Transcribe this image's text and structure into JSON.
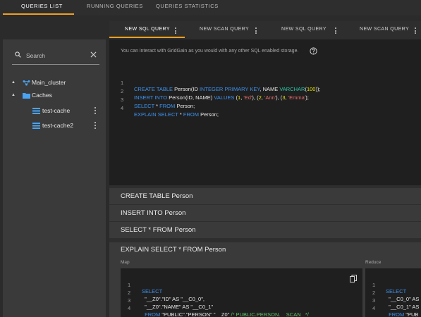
{
  "top_tabs": [
    "QUERIES LIST",
    "RUNNING QUERIES",
    "QUERIES STATISTICS"
  ],
  "query_tabs": [
    "NEW SQL QUERY",
    "NEW SCAN QUERY",
    "NEW SQL QUERY",
    "NEW SCAN QUERY"
  ],
  "sidebar": {
    "search_placeholder": "Search",
    "tree": {
      "cluster": "Main_cluster",
      "caches_folder": "Caches",
      "caches": [
        "test-cache",
        "test-cache2"
      ]
    }
  },
  "editor": {
    "hint": "You can interact with GridGain as you would with any other SQL enabled storage.",
    "line_numbers": [
      "1",
      "2",
      "3",
      "4"
    ]
  },
  "results": {
    "rows": [
      "CREATE TABLE Person",
      "INSERT INTO Person",
      "SELECT * FROM Person"
    ],
    "explain_title": "EXPLAIN SELECT * FROM Person",
    "map_label": "Map",
    "reduce_label": "Reduce",
    "map_line_numbers": [
      "1",
      "2",
      "3",
      "4"
    ],
    "reduce_line_numbers": [
      "1",
      "2",
      "3",
      "4"
    ]
  },
  "colors": {
    "accent": "#f0a020",
    "keyword": "#3d93f0",
    "number": "#e8e800",
    "string": "#e66b6b",
    "function": "#2ec7a8",
    "comment": "#5fc06a"
  }
}
